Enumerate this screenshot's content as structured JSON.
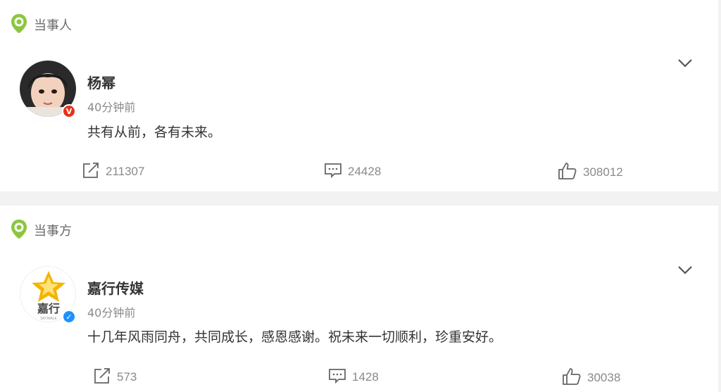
{
  "posts": [
    {
      "tag": "当事人",
      "name": "杨幂",
      "time": "40分钟前",
      "text": "共有从前，各有未来。",
      "verified_type": "orange",
      "actions": {
        "repost": "211307",
        "comment": "24428",
        "like": "308012"
      }
    },
    {
      "tag": "当事方",
      "name": "嘉行传媒",
      "time": "40分钟前",
      "text": "十几年风雨同舟，共同成长，感恩感谢。祝未来一切顺利，珍重安好。",
      "verified_type": "blue",
      "avatar_text": "嘉行",
      "avatar_subtext": "SKYWALK",
      "actions": {
        "repost": "573",
        "comment": "1428",
        "like": "30038"
      }
    }
  ],
  "colors": {
    "tag_icon": "#8cc63f",
    "orange_badge": "#e8301a",
    "blue_badge": "#1e90ff",
    "star": "#f4b400"
  }
}
